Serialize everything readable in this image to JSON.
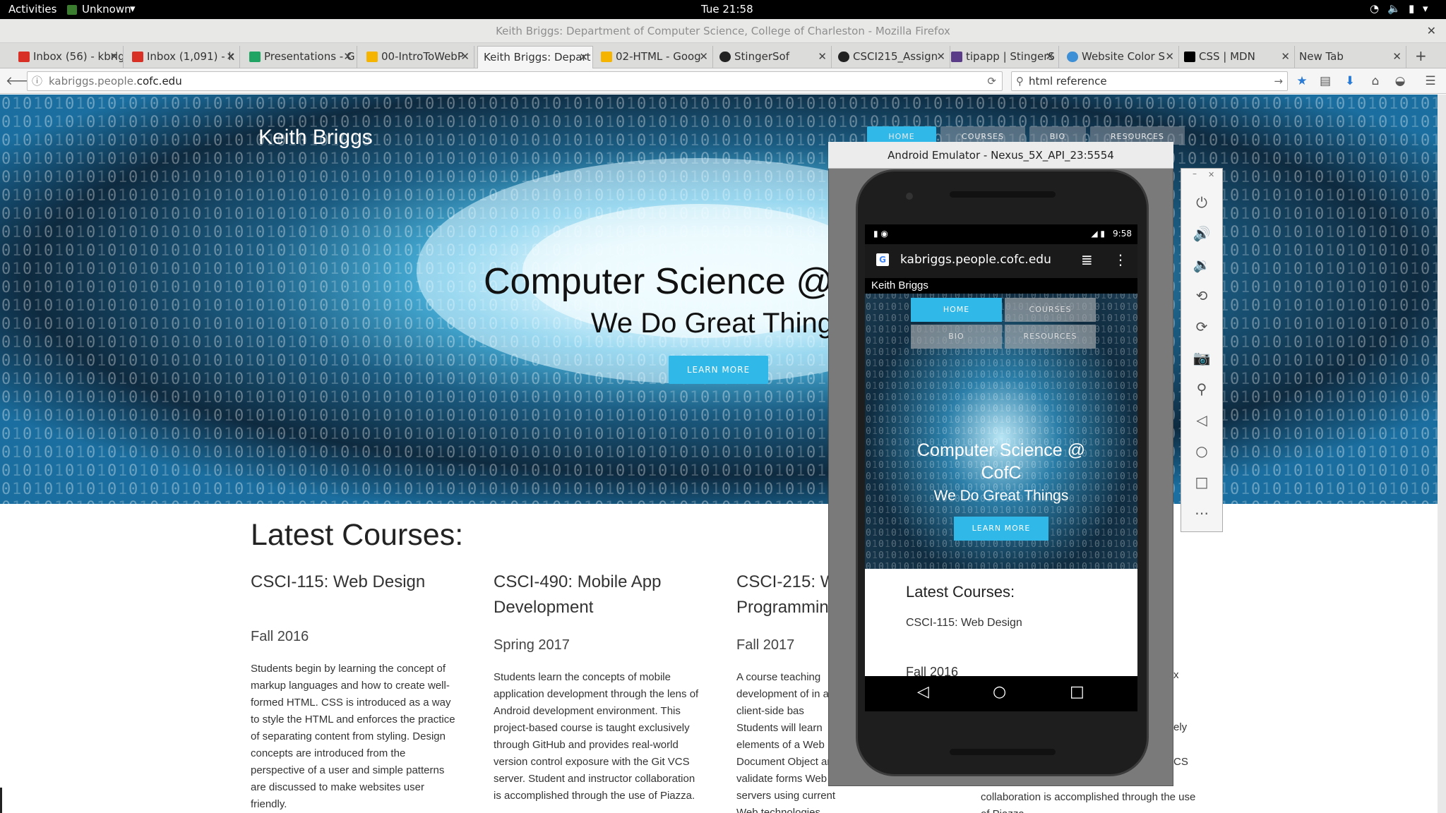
{
  "topbar": {
    "activities": "Activities",
    "app": "Unknown",
    "clock": "Tue 21:58"
  },
  "window_title": "Keith Briggs: Department of Computer Science, College of Charleston - Mozilla Firefox",
  "tabs": [
    {
      "label": "Inbox (56) - kbrig",
      "icon_color": "#d93025"
    },
    {
      "label": "Inbox (1,091) - k",
      "icon_color": "#d93025"
    },
    {
      "label": "Presentations - G",
      "icon_color": "#1fa463"
    },
    {
      "label": "00-IntroToWebP",
      "icon_color": "#f4b400"
    },
    {
      "label": "Keith Briggs: Depart",
      "icon_color": "none"
    },
    {
      "label": "02-HTML - Goog",
      "icon_color": "#f4b400"
    },
    {
      "label": "StingerSof",
      "icon_color": "#222"
    },
    {
      "label": "CSCI215_Assign",
      "icon_color": "#222"
    },
    {
      "label": "tipapp | StingerS",
      "icon_color": "#5b3c88"
    },
    {
      "label": "Website Color S",
      "icon_color": "#3d8fd6"
    },
    {
      "label": "CSS | MDN",
      "icon_color": "#000"
    },
    {
      "label": "New Tab",
      "icon_color": "none"
    }
  ],
  "address": {
    "url_host": "kabriggs.people.",
    "url_domain": "cofc.edu",
    "search": "html reference"
  },
  "site": {
    "name": "Keith Briggs",
    "nav": [
      "HOME",
      "COURSES",
      "BIO",
      "RESOURCES"
    ],
    "hero_title": "Computer Science @",
    "hero_subtitle": "We Do Great Thing",
    "learn_more": "LEARN MORE",
    "latest": "Latest Courses:",
    "courses": [
      {
        "title": "CSCI-115: Web Design",
        "term": "Fall 2016",
        "desc": "Students begin by learning the concept of markup languages and how to create well-formed HTML. CSS is introduced as a way to style the HTML and enforces the practice of separating content from styling. Design concepts are introduced from the perspective of a user and simple patterns are discussed to make websites user friendly."
      },
      {
        "title": "CSCI-490: Mobile App Development",
        "term": "Spring 2017",
        "desc": "Students learn the concepts of mobile application development through the lens of Android development environment. This project-based course is taught exclusively through GitHub and provides real-world version control exposure with the Git VCS server. Student and instructor collaboration is accomplished through the use of Piazza."
      },
      {
        "title": "CSCI-215: W Programmin",
        "term": "Fall 2017",
        "desc": "A course teaching development of in and client-side bas Students will learn elements of a Web Document Object and validate forms Web servers using current Web technologies."
      }
    ],
    "col4_fragments": [
      "x",
      "ely",
      "CS",
      "collaboration is accomplished through the use of Piazza."
    ]
  },
  "emulator": {
    "title": "Android Emulator - Nexus_5X_API_23:5554",
    "status_time": "9:58",
    "url": "kabriggs.people.cofc.edu",
    "site_name": "Keith Briggs",
    "nav": [
      "HOME",
      "COURSES",
      "BIO",
      "RESOURCES"
    ],
    "hero_title": "Computer Science @ CofC",
    "hero_subtitle": "We Do Great Things",
    "learn_more": "LEARN MORE",
    "latest": "Latest Courses:",
    "course": "CSCI-115: Web Design",
    "term": "Fall 2016"
  }
}
